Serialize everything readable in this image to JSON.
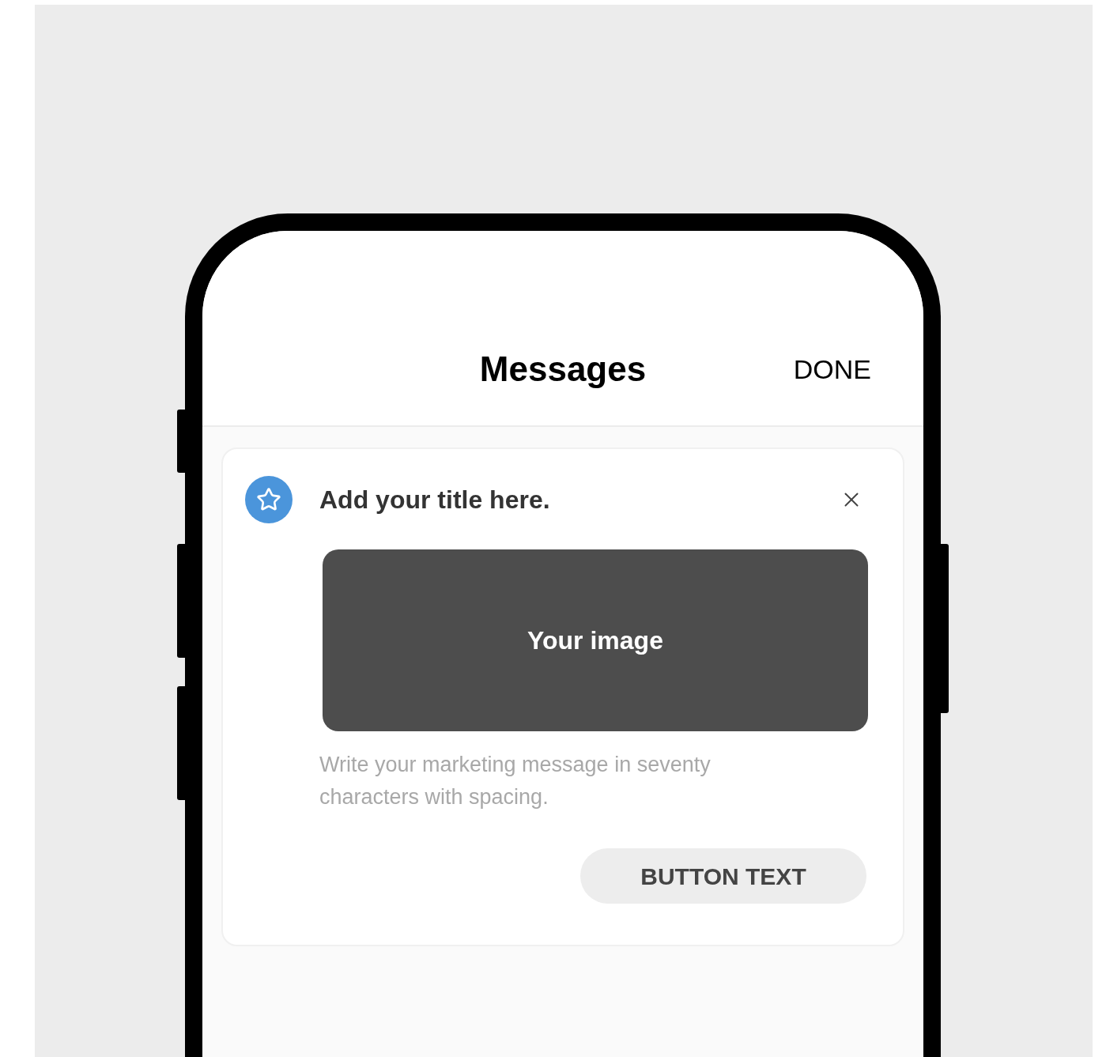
{
  "header": {
    "title": "Messages",
    "action": "DONE"
  },
  "card": {
    "title": "Add your title here.",
    "image_label": "Your image",
    "message": "Write your marketing message in seventy characters with spacing.",
    "button": "BUTTON TEXT"
  }
}
